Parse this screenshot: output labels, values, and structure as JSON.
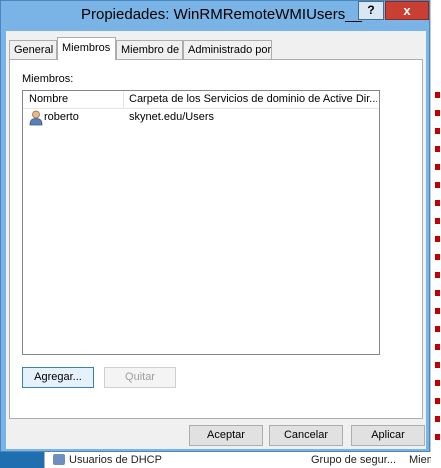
{
  "window": {
    "title": "Propiedades: WinRMRemoteWMIUsers__"
  },
  "titlebar": {
    "help_label": "?",
    "close_label": "x"
  },
  "tabs": [
    {
      "label": "General"
    },
    {
      "label": "Miembros",
      "active": true
    },
    {
      "label": "Miembro de"
    },
    {
      "label": "Administrado por"
    }
  ],
  "members": {
    "section_label": "Miembros:",
    "columns": [
      "Nombre",
      "Carpeta de los Servicios de dominio de Active Dir..."
    ],
    "rows": [
      {
        "name": "roberto",
        "folder": "skynet.edu/Users",
        "icon": "user-icon"
      }
    ],
    "add_label": "Agregar...",
    "remove_label": "Quitar"
  },
  "footer": {
    "ok_label": "Aceptar",
    "cancel_label": "Cancelar",
    "apply_label": "Aplicar"
  },
  "background": {
    "row_name": "Usuarios de DHCP",
    "row_type": "Grupo de segur...",
    "row_extra": "Miem"
  },
  "colors": {
    "titlebar": "#7ab3e5",
    "close_button": "#c94033",
    "desktop": "#1f6fb0"
  }
}
